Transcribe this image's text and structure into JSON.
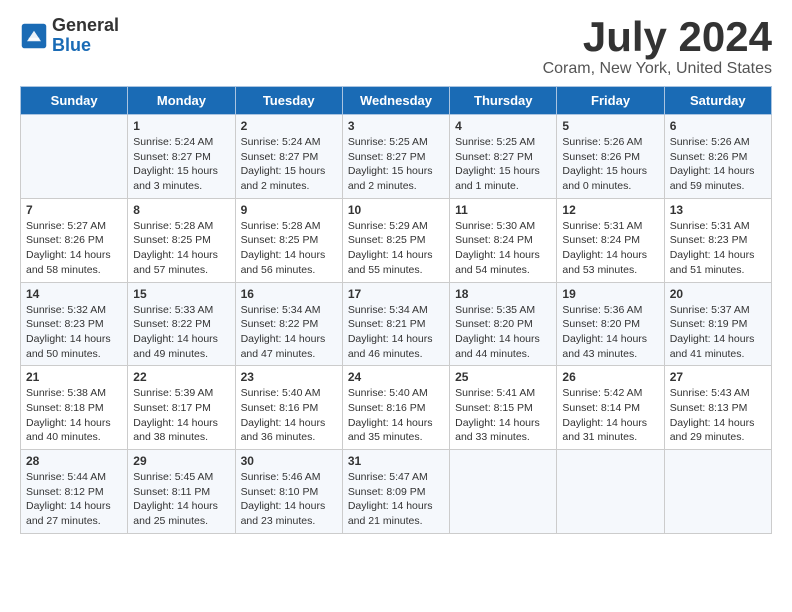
{
  "logo": {
    "general": "General",
    "blue": "Blue"
  },
  "title": "July 2024",
  "location": "Coram, New York, United States",
  "days_of_week": [
    "Sunday",
    "Monday",
    "Tuesday",
    "Wednesday",
    "Thursday",
    "Friday",
    "Saturday"
  ],
  "weeks": [
    [
      {
        "day": "",
        "info": ""
      },
      {
        "day": "1",
        "info": "Sunrise: 5:24 AM\nSunset: 8:27 PM\nDaylight: 15 hours\nand 3 minutes."
      },
      {
        "day": "2",
        "info": "Sunrise: 5:24 AM\nSunset: 8:27 PM\nDaylight: 15 hours\nand 2 minutes."
      },
      {
        "day": "3",
        "info": "Sunrise: 5:25 AM\nSunset: 8:27 PM\nDaylight: 15 hours\nand 2 minutes."
      },
      {
        "day": "4",
        "info": "Sunrise: 5:25 AM\nSunset: 8:27 PM\nDaylight: 15 hours\nand 1 minute."
      },
      {
        "day": "5",
        "info": "Sunrise: 5:26 AM\nSunset: 8:26 PM\nDaylight: 15 hours\nand 0 minutes."
      },
      {
        "day": "6",
        "info": "Sunrise: 5:26 AM\nSunset: 8:26 PM\nDaylight: 14 hours\nand 59 minutes."
      }
    ],
    [
      {
        "day": "7",
        "info": "Sunrise: 5:27 AM\nSunset: 8:26 PM\nDaylight: 14 hours\nand 58 minutes."
      },
      {
        "day": "8",
        "info": "Sunrise: 5:28 AM\nSunset: 8:25 PM\nDaylight: 14 hours\nand 57 minutes."
      },
      {
        "day": "9",
        "info": "Sunrise: 5:28 AM\nSunset: 8:25 PM\nDaylight: 14 hours\nand 56 minutes."
      },
      {
        "day": "10",
        "info": "Sunrise: 5:29 AM\nSunset: 8:25 PM\nDaylight: 14 hours\nand 55 minutes."
      },
      {
        "day": "11",
        "info": "Sunrise: 5:30 AM\nSunset: 8:24 PM\nDaylight: 14 hours\nand 54 minutes."
      },
      {
        "day": "12",
        "info": "Sunrise: 5:31 AM\nSunset: 8:24 PM\nDaylight: 14 hours\nand 53 minutes."
      },
      {
        "day": "13",
        "info": "Sunrise: 5:31 AM\nSunset: 8:23 PM\nDaylight: 14 hours\nand 51 minutes."
      }
    ],
    [
      {
        "day": "14",
        "info": "Sunrise: 5:32 AM\nSunset: 8:23 PM\nDaylight: 14 hours\nand 50 minutes."
      },
      {
        "day": "15",
        "info": "Sunrise: 5:33 AM\nSunset: 8:22 PM\nDaylight: 14 hours\nand 49 minutes."
      },
      {
        "day": "16",
        "info": "Sunrise: 5:34 AM\nSunset: 8:22 PM\nDaylight: 14 hours\nand 47 minutes."
      },
      {
        "day": "17",
        "info": "Sunrise: 5:34 AM\nSunset: 8:21 PM\nDaylight: 14 hours\nand 46 minutes."
      },
      {
        "day": "18",
        "info": "Sunrise: 5:35 AM\nSunset: 8:20 PM\nDaylight: 14 hours\nand 44 minutes."
      },
      {
        "day": "19",
        "info": "Sunrise: 5:36 AM\nSunset: 8:20 PM\nDaylight: 14 hours\nand 43 minutes."
      },
      {
        "day": "20",
        "info": "Sunrise: 5:37 AM\nSunset: 8:19 PM\nDaylight: 14 hours\nand 41 minutes."
      }
    ],
    [
      {
        "day": "21",
        "info": "Sunrise: 5:38 AM\nSunset: 8:18 PM\nDaylight: 14 hours\nand 40 minutes."
      },
      {
        "day": "22",
        "info": "Sunrise: 5:39 AM\nSunset: 8:17 PM\nDaylight: 14 hours\nand 38 minutes."
      },
      {
        "day": "23",
        "info": "Sunrise: 5:40 AM\nSunset: 8:16 PM\nDaylight: 14 hours\nand 36 minutes."
      },
      {
        "day": "24",
        "info": "Sunrise: 5:40 AM\nSunset: 8:16 PM\nDaylight: 14 hours\nand 35 minutes."
      },
      {
        "day": "25",
        "info": "Sunrise: 5:41 AM\nSunset: 8:15 PM\nDaylight: 14 hours\nand 33 minutes."
      },
      {
        "day": "26",
        "info": "Sunrise: 5:42 AM\nSunset: 8:14 PM\nDaylight: 14 hours\nand 31 minutes."
      },
      {
        "day": "27",
        "info": "Sunrise: 5:43 AM\nSunset: 8:13 PM\nDaylight: 14 hours\nand 29 minutes."
      }
    ],
    [
      {
        "day": "28",
        "info": "Sunrise: 5:44 AM\nSunset: 8:12 PM\nDaylight: 14 hours\nand 27 minutes."
      },
      {
        "day": "29",
        "info": "Sunrise: 5:45 AM\nSunset: 8:11 PM\nDaylight: 14 hours\nand 25 minutes."
      },
      {
        "day": "30",
        "info": "Sunrise: 5:46 AM\nSunset: 8:10 PM\nDaylight: 14 hours\nand 23 minutes."
      },
      {
        "day": "31",
        "info": "Sunrise: 5:47 AM\nSunset: 8:09 PM\nDaylight: 14 hours\nand 21 minutes."
      },
      {
        "day": "",
        "info": ""
      },
      {
        "day": "",
        "info": ""
      },
      {
        "day": "",
        "info": ""
      }
    ]
  ]
}
